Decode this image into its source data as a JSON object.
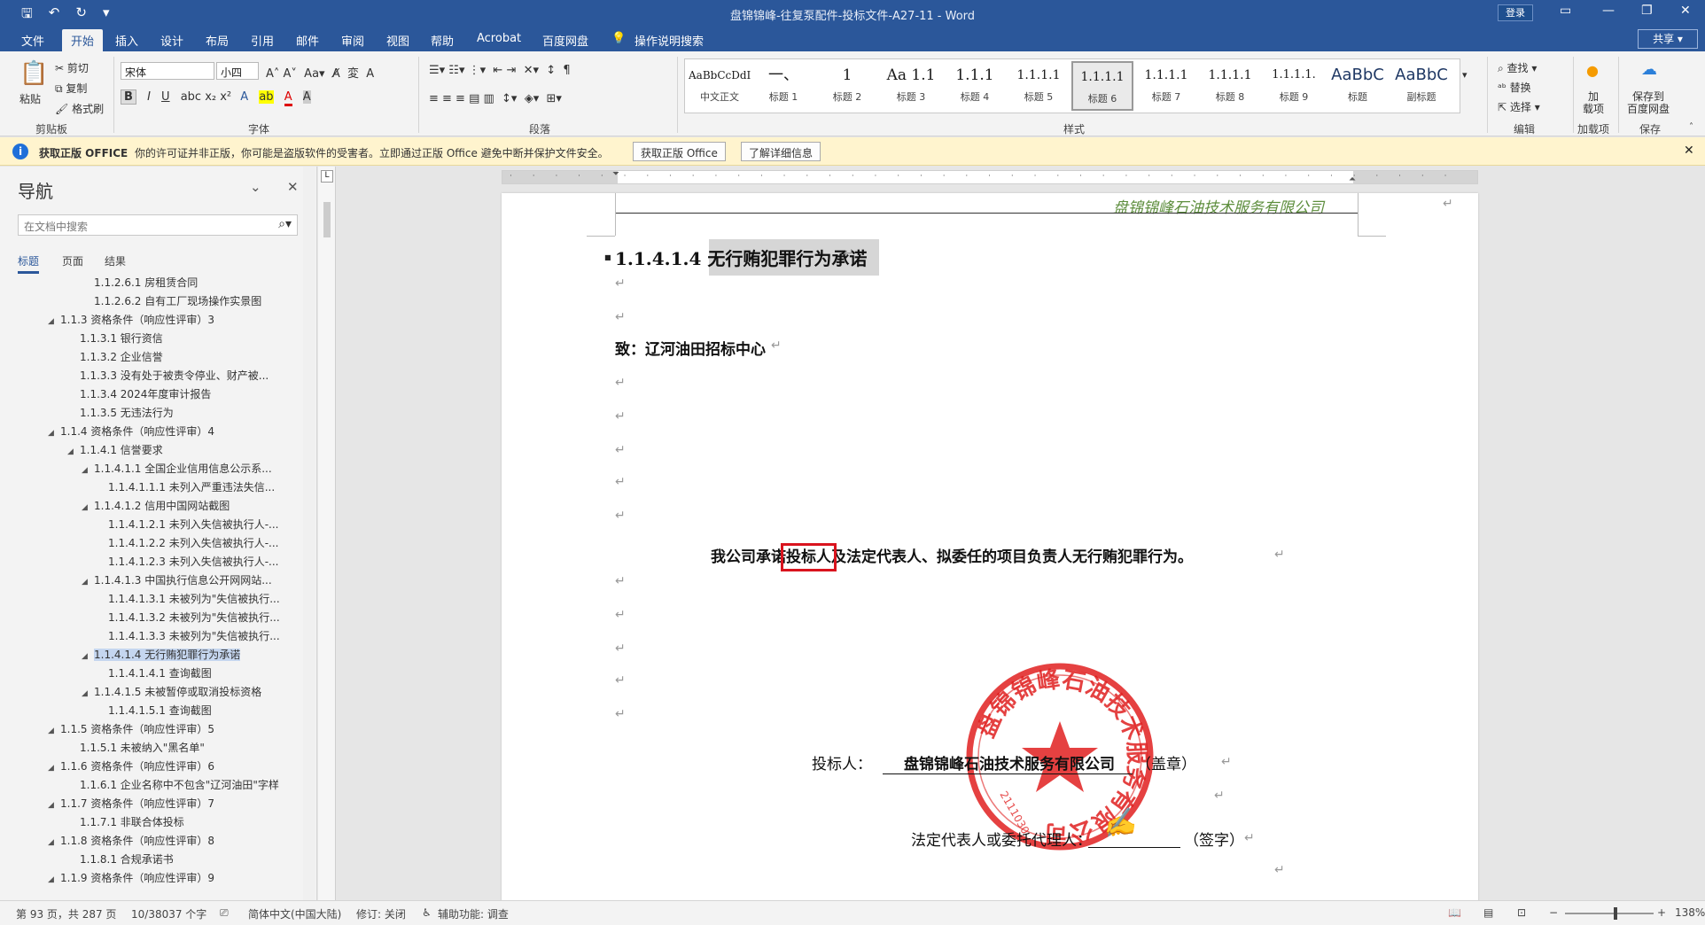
{
  "titlebar": {
    "doc_title": "盘锦锦峰-往复泵配件-投标文件-A27-11  -  Word",
    "login": "登录",
    "qat": {
      "save": "🖫",
      "undo": "↶",
      "redo": "↻",
      "more": "▾"
    }
  },
  "menu": {
    "tabs": [
      "文件",
      "开始",
      "插入",
      "设计",
      "布局",
      "引用",
      "邮件",
      "审阅",
      "视图",
      "帮助",
      "Acrobat",
      "百度网盘"
    ],
    "tell_me": "操作说明搜索",
    "share": "共享"
  },
  "ribbon": {
    "clipboard": {
      "paste": "粘贴",
      "cut": "剪切",
      "copy": "复制",
      "format_painter": "格式刷",
      "group": "剪贴板"
    },
    "font": {
      "name": "宋体",
      "size": "小四",
      "group": "字体",
      "bold": "B",
      "italic": "I",
      "underline": "U"
    },
    "paragraph": {
      "group": "段落"
    },
    "styles": {
      "group": "样式",
      "items": [
        {
          "preview": "AaBbCcDdI",
          "name": "中文正文"
        },
        {
          "preview": "一、",
          "name": "标题 1"
        },
        {
          "preview": "1",
          "name": "标题 2"
        },
        {
          "preview": "Aa 1.1",
          "name": "标题 3"
        },
        {
          "preview": "1.1.1",
          "name": "标题 4"
        },
        {
          "preview": "1.1.1.1",
          "name": "标题 5"
        },
        {
          "preview": "1.1.1.1",
          "name": "标题 6"
        },
        {
          "preview": "1.1.1.1",
          "name": "标题 7"
        },
        {
          "preview": "1.1.1.1",
          "name": "标题 8"
        },
        {
          "preview": "1.1.1.1.",
          "name": "标题 9"
        },
        {
          "preview": "AaBbC",
          "name": "标题"
        },
        {
          "preview": "AaBbC",
          "name": "副标题"
        }
      ]
    },
    "editing": {
      "find": "查找",
      "replace": "替换",
      "select": "选择",
      "group": "编辑"
    },
    "addins": {
      "label": "加\n载项",
      "group": "加载项"
    },
    "save": {
      "label": "保存到\n百度网盘",
      "group": "保存"
    }
  },
  "message_bar": {
    "title": "获取正版 OFFICE",
    "text": "你的许可证并非正版，你可能是盗版软件的受害者。立即通过正版 Office 避免中断并保护文件安全。",
    "btn_genuine": "获取正版 Office",
    "btn_details": "了解详细信息"
  },
  "nav": {
    "title": "导航",
    "search_placeholder": "在文档中搜索",
    "tabs": [
      "标题",
      "页面",
      "结果"
    ],
    "items": [
      {
        "level": 3,
        "text": "1.1.2.6.1 房租赁合同",
        "tri": ""
      },
      {
        "level": 3,
        "text": "1.1.2.6.2 自有工厂现场操作实景图",
        "tri": ""
      },
      {
        "level": 1,
        "text": "1.1.3 资格条件（响应性评审）3",
        "tri": "◢"
      },
      {
        "level": 2,
        "text": "1.1.3.1 银行资信",
        "tri": ""
      },
      {
        "level": 2,
        "text": "1.1.3.2 企业信誉",
        "tri": ""
      },
      {
        "level": 2,
        "text": "1.1.3.3 没有处于被责令停业、财产被...",
        "tri": ""
      },
      {
        "level": 2,
        "text": "1.1.3.4 2024年度审计报告",
        "tri": ""
      },
      {
        "level": 2,
        "text": "1.1.3.5 无违法行为",
        "tri": ""
      },
      {
        "level": 1,
        "text": "1.1.4 资格条件（响应性评审）4",
        "tri": "◢"
      },
      {
        "level": 2,
        "text": "1.1.4.1 信誉要求",
        "tri": "◢"
      },
      {
        "level": 3,
        "text": "1.1.4.1.1 全国企业信用信息公示系...",
        "tri": "◢"
      },
      {
        "level": 4,
        "text": "1.1.4.1.1.1 未列入严重违法失信...",
        "tri": ""
      },
      {
        "level": 3,
        "text": "1.1.4.1.2 信用中国网站截图",
        "tri": "◢"
      },
      {
        "level": 4,
        "text": "1.1.4.1.2.1 未列入失信被执行人-...",
        "tri": ""
      },
      {
        "level": 4,
        "text": "1.1.4.1.2.2 未列入失信被执行人-...",
        "tri": ""
      },
      {
        "level": 4,
        "text": "1.1.4.1.2.3 未列入失信被执行人-...",
        "tri": ""
      },
      {
        "level": 3,
        "text": "1.1.4.1.3 中国执行信息公开网网站...",
        "tri": "◢"
      },
      {
        "level": 4,
        "text": "1.1.4.1.3.1 未被列为\"失信被执行...",
        "tri": ""
      },
      {
        "level": 4,
        "text": "1.1.4.1.3.2 未被列为\"失信被执行...",
        "tri": ""
      },
      {
        "level": 4,
        "text": "1.1.4.1.3.3 未被列为\"失信被执行...",
        "tri": ""
      },
      {
        "level": 3,
        "text": "1.1.4.1.4 无行贿犯罪行为承诺",
        "tri": "◢",
        "selected": true
      },
      {
        "level": 4,
        "text": "1.1.4.1.4.1 查询截图",
        "tri": ""
      },
      {
        "level": 3,
        "text": "1.1.4.1.5 未被暂停或取消投标资格",
        "tri": "◢"
      },
      {
        "level": 4,
        "text": "1.1.4.1.5.1 查询截图",
        "tri": ""
      },
      {
        "level": 1,
        "text": "1.1.5 资格条件（响应性评审）5",
        "tri": "◢"
      },
      {
        "level": 2,
        "text": "1.1.5.1 未被纳入\"黑名单\"",
        "tri": ""
      },
      {
        "level": 1,
        "text": "1.1.6 资格条件（响应性评审）6",
        "tri": "◢"
      },
      {
        "level": 2,
        "text": "1.1.6.1 企业名称中不包含\"辽河油田\"字样",
        "tri": ""
      },
      {
        "level": 1,
        "text": "1.1.7 资格条件（响应性评审）7",
        "tri": "◢"
      },
      {
        "level": 2,
        "text": "1.1.7.1 非联合体投标",
        "tri": ""
      },
      {
        "level": 1,
        "text": "1.1.8 资格条件（响应性评审）8",
        "tri": "◢"
      },
      {
        "level": 2,
        "text": "1.1.8.1 合规承诺书",
        "tri": ""
      },
      {
        "level": 1,
        "text": "1.1.9 资格条件（响应性评审）9",
        "tri": "◢"
      }
    ]
  },
  "document": {
    "header_company": "盘锦锦峰石油技术服务有限公司",
    "heading": "1.1.4.1.4 无行贿犯罪行为承诺",
    "to_line": "致：辽河油田招标中心",
    "commit_pre": "我公司承诺",
    "commit_box": "投标人",
    "commit_post": "及法定代表人、拟委任的项目负责人无行贿犯罪行为。",
    "bidder_label": "投标人：",
    "bidder_value": "盘锦锦峰石油技术服务有限公司",
    "seal_note": "（盖章）",
    "rep_label": "法定代表人或委托代理人：",
    "sign_note": "（签字）",
    "seal_text": "盘锦锦峰石油技术服务有限公司",
    "seal_code": "2111030",
    "signature": "张迪"
  },
  "statusbar": {
    "page": "第 93 页，共 287 页",
    "words": "10/38037 个字",
    "language": "简体中文(中国大陆)",
    "track": "修订: 关闭",
    "accessibility": "辅助功能: 调查",
    "zoom": "138%"
  },
  "colors": {
    "brand": "#2b579a",
    "header_green": "#5e8e3e",
    "seal_red": "#e02020",
    "highlight_box": "#d9141e"
  }
}
